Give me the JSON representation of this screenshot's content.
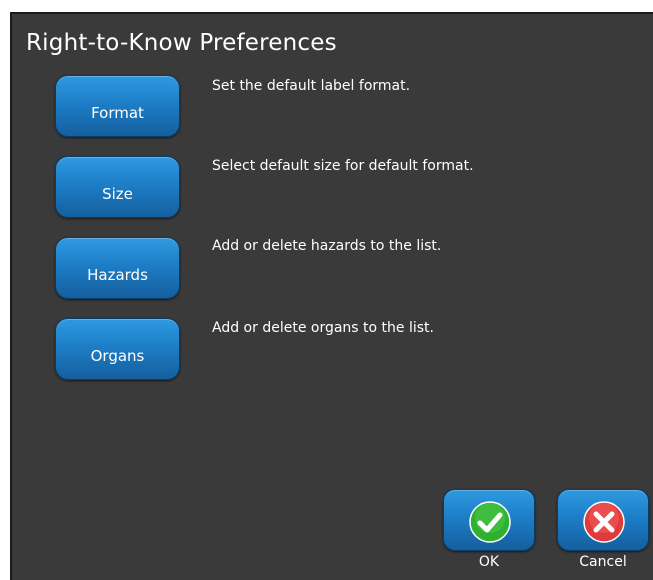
{
  "dialog": {
    "title": "Right-to-Know Preferences"
  },
  "preferences": [
    {
      "label": "Format",
      "description": "Set the default label format."
    },
    {
      "label": "Size",
      "description": "Select default size for default format."
    },
    {
      "label": "Hazards",
      "description": "Add or delete hazards to the list."
    },
    {
      "label": "Organs",
      "description": "Add or delete organs to the list."
    }
  ],
  "actions": {
    "ok_label": "OK",
    "cancel_label": "Cancel"
  },
  "icons": {
    "ok": "check-circle-icon",
    "cancel": "x-circle-icon"
  },
  "colors": {
    "panel_background": "#3a3a3a",
    "button_blue": "#1d7ec7",
    "ok_green": "#2fb12f",
    "cancel_red": "#e03a3a"
  }
}
